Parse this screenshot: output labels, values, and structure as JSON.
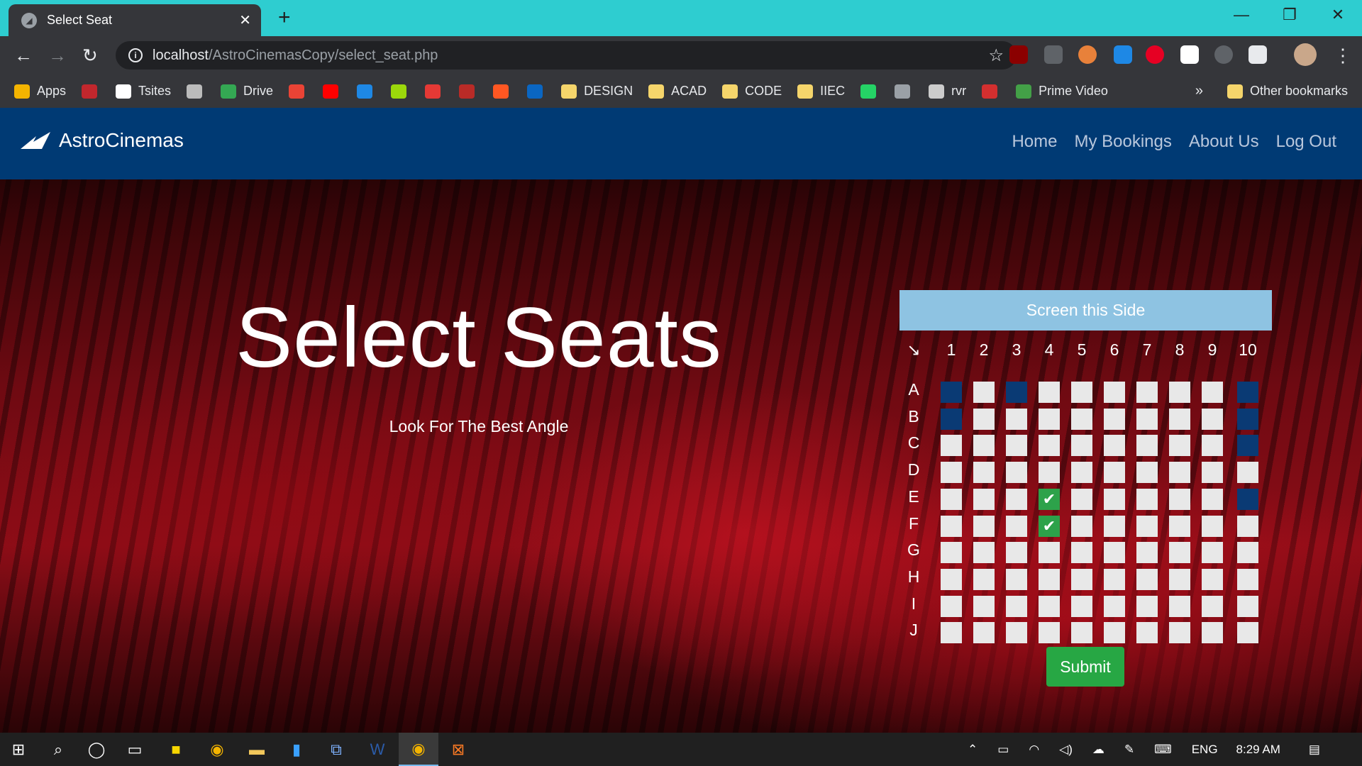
{
  "browser": {
    "tab_title": "Select Seat",
    "new_tab_label": "+",
    "url_host": "localhost",
    "url_path": "/AstroCinemasCopy/select_seat.php"
  },
  "bookmarks": {
    "items": [
      {
        "label": "Apps",
        "icon": "apps-grid-icon",
        "color": "#f4b400"
      },
      {
        "label": "",
        "icon": "globe-icon",
        "color": "#c2272d"
      },
      {
        "label": "Tsites",
        "icon": "tools-icon",
        "color": "#ffffff"
      },
      {
        "label": "",
        "icon": "ub-icon",
        "color": "#bbbbbb"
      },
      {
        "label": "Drive",
        "icon": "google-drive-icon",
        "color": "#34a853"
      },
      {
        "label": "",
        "icon": "gmail-icon",
        "color": "#ea4335"
      },
      {
        "label": "",
        "icon": "youtube-icon",
        "color": "#ff0000"
      },
      {
        "label": "",
        "icon": "tdf-icon",
        "color": "#1e88e5"
      },
      {
        "label": "",
        "icon": "spark-icon",
        "color": "#9bd80b"
      },
      {
        "label": "",
        "icon": "ball-icon",
        "color": "#e53935"
      },
      {
        "label": "",
        "icon": "quora-icon",
        "color": "#b92b27"
      },
      {
        "label": "",
        "icon": "g-icon",
        "color": "#ff5722"
      },
      {
        "label": "",
        "icon": "linkedin-icon",
        "color": "#0a66c2"
      },
      {
        "label": "DESIGN",
        "icon": "folder-icon",
        "color": "#f5d56b"
      },
      {
        "label": "ACAD",
        "icon": "folder-icon",
        "color": "#f5d56b"
      },
      {
        "label": "CODE",
        "icon": "folder-icon",
        "color": "#f5d56b"
      },
      {
        "label": "IIEC",
        "icon": "folder-icon",
        "color": "#f5d56b"
      },
      {
        "label": "",
        "icon": "whatsapp-icon",
        "color": "#25d366"
      },
      {
        "label": "",
        "icon": "astro-icon",
        "color": "#9aa0a6"
      },
      {
        "label": "rvr",
        "icon": "rvr-icon",
        "color": "#cccccc"
      },
      {
        "label": "",
        "icon": "speedometer-icon",
        "color": "#d32f2f"
      },
      {
        "label": "Prime Video",
        "icon": "play-icon",
        "color": "#43a047"
      }
    ],
    "overflow": "»",
    "other": "Other bookmarks"
  },
  "site": {
    "brand": "AstroCinemas",
    "nav": [
      "Home",
      "My Bookings",
      "About Us",
      "Log Out"
    ]
  },
  "hero": {
    "title": "Select Seats",
    "subtitle": "Look For The Best Angle"
  },
  "seating": {
    "screen_label": "Screen this Side",
    "corner": "↘",
    "columns": [
      "1",
      "2",
      "3",
      "4",
      "5",
      "6",
      "7",
      "8",
      "9",
      "10"
    ],
    "rows": [
      "A",
      "B",
      "C",
      "D",
      "E",
      "F",
      "G",
      "H",
      "I",
      "J"
    ],
    "booked": [
      "A1",
      "A3",
      "A10",
      "B1",
      "B10",
      "C10",
      "E10"
    ],
    "selected": [
      "E4",
      "F4"
    ],
    "selected_mark": "✔",
    "submit_label": "Submit"
  },
  "taskbar": {
    "language": "ENG",
    "time": "8:29 AM"
  },
  "colors": {
    "nav_bg": "#003a74",
    "screen_bg": "#8ec3e2",
    "seat_free": "#e8e8e8",
    "seat_booked": "#0a3a74",
    "seat_selected": "#2da24a",
    "submit_bg": "#27a744",
    "tabbar_bg": "#2ecdd0"
  }
}
